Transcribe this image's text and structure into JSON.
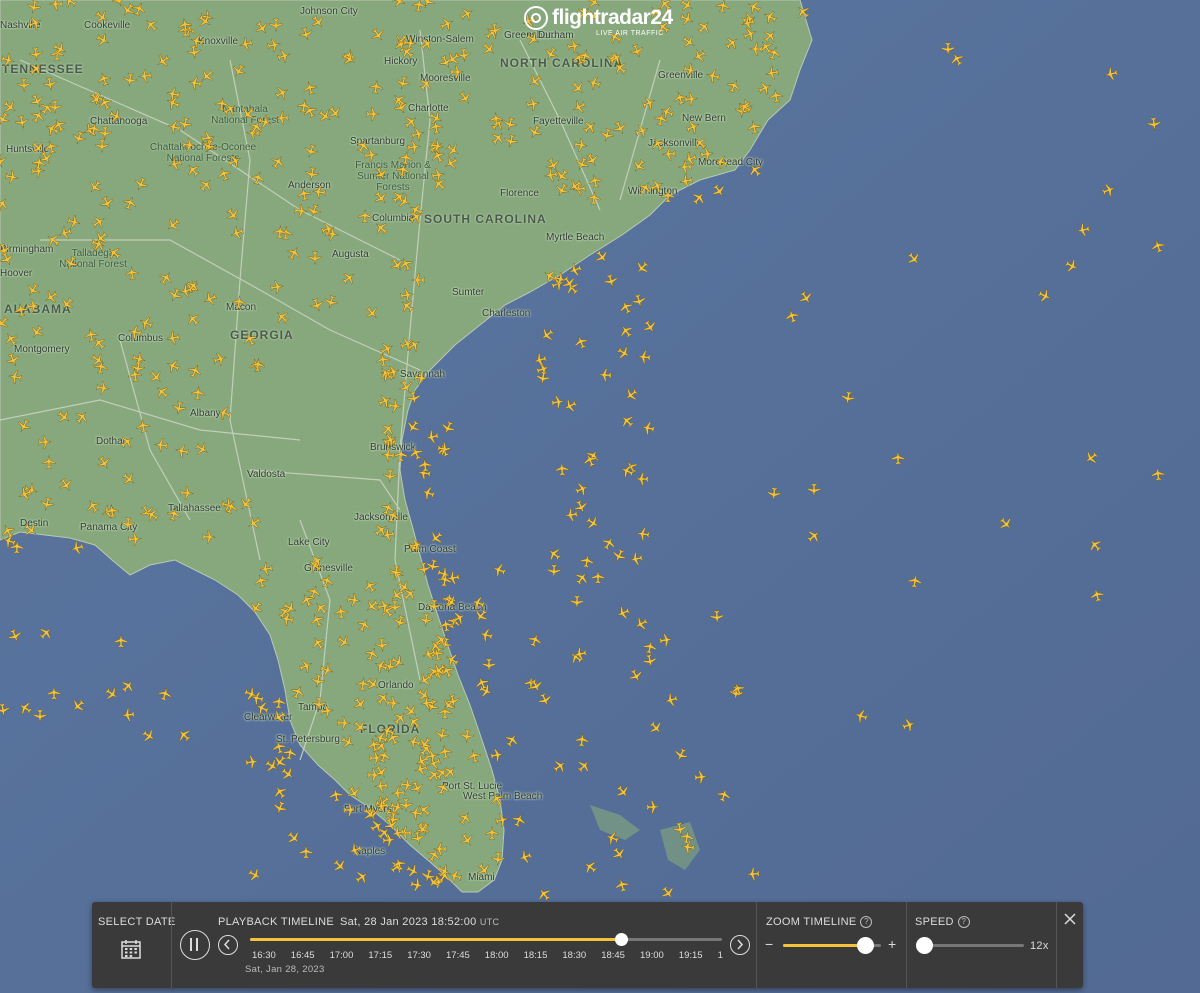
{
  "app": {
    "brand": "flightradar24",
    "tagline": "LIVE AIR TRAFFIC"
  },
  "map": {
    "colors": {
      "sea": "#56709a",
      "land": "#8aab80",
      "plane": "#f5c33b"
    },
    "states": [
      "NORTH CAROLINA",
      "SOUTH CAROLINA",
      "GEORGIA",
      "ALABAMA",
      "FLORIDA",
      "TENNESSEE"
    ],
    "cities": [
      "Nashville",
      "Cookeville",
      "Johnson City",
      "Winston-Salem",
      "Greensboro",
      "Durham",
      "Knoxville",
      "Hickory",
      "Mooresville",
      "Charlotte",
      "Fayetteville",
      "Greenville",
      "New Bern",
      "Chattanooga",
      "Spartanburg",
      "Huntsville",
      "Anderson",
      "Florence",
      "Jacksonville",
      "Morehead City",
      "Wilmington",
      "Myrtle Beach",
      "Columbia",
      "Birmingham",
      "Hoover",
      "Augusta",
      "Sumter",
      "Charleston",
      "Macon",
      "Columbus",
      "Montgomery",
      "Savannah",
      "Albany",
      "Dothan",
      "Brunswick",
      "Valdosta",
      "Tallahassee",
      "Destin",
      "Panama City",
      "Jacksonville",
      "Lake City",
      "Gainesville",
      "Palm Coast",
      "Daytona Beach",
      "Orlando",
      "Clearwater",
      "Tampa",
      "St. Petersburg",
      "Port St. Lucie",
      "Fort Myers",
      "West Palm Beach",
      "Naples",
      "Miami"
    ],
    "parks": [
      "Nantahala National Forest",
      "Chattahoochee-Oconee National Forests",
      "Francis Marion & Sumter National Forests",
      "Talladega National Forest"
    ]
  },
  "controls": {
    "select_date_label": "SELECT DATE",
    "playback_label": "PLAYBACK TIMELINE",
    "current_datetime": "Sat, 28 Jan 2023 18:52:00",
    "tz": "UTC",
    "timeline_date": "Sat, Jan 28, 2023",
    "ticks": [
      "16:30",
      "16:45",
      "17:00",
      "17:15",
      "17:30",
      "17:45",
      "18:00",
      "18:15",
      "18:30",
      "18:45",
      "19:00",
      "19:15",
      "1"
    ],
    "playback_progress": 0.786,
    "zoom_label": "ZOOM TIMELINE",
    "zoom_level": 0.84,
    "speed_label": "SPEED",
    "speed_value": "12x",
    "speed_level": 0.0,
    "help_glyph": "?",
    "minus_glyph": "−",
    "plus_glyph": "+"
  }
}
